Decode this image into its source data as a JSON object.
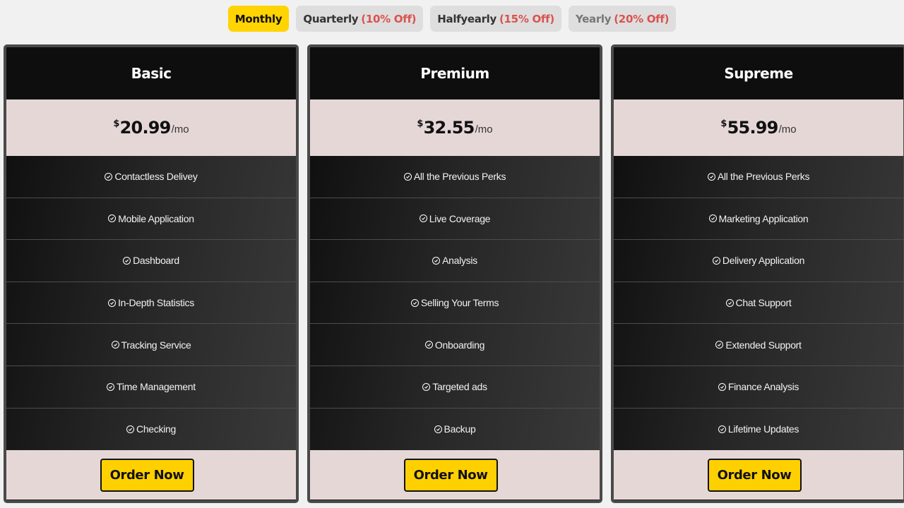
{
  "tabs": [
    {
      "label": "Monthly",
      "off": ""
    },
    {
      "label": "Quarterly",
      "off": "(10% Off)"
    },
    {
      "label": "Halfyearly",
      "off": "(15% Off)"
    },
    {
      "label": "Yearly",
      "off": "(20% Off)"
    }
  ],
  "currency_symbol": "$",
  "per_label": "/mo",
  "order_label": "Order Now",
  "plans": [
    {
      "name": "Basic",
      "price": "20.99",
      "features": [
        "Contactless Delivey",
        "Mobile Application",
        "Dashboard",
        "In-Depth Statistics",
        "Tracking Service",
        "Time Management",
        "Checking"
      ]
    },
    {
      "name": "Premium",
      "price": "32.55",
      "features": [
        "All the Previous Perks",
        "Live Coverage",
        "Analysis",
        "Selling Your Terms",
        "Onboarding",
        "Targeted ads",
        "Backup"
      ]
    },
    {
      "name": "Supreme",
      "price": "55.99",
      "features": [
        "All the Previous Perks",
        "Marketing Application",
        "Delivery Application",
        "Chat Support",
        "Extended Support",
        "Finance Analysis",
        "Lifetime Updates"
      ]
    }
  ],
  "colors": {
    "accent": "#ffd400",
    "discount": "#d9534f",
    "price_bg": "#e6d7d7"
  }
}
